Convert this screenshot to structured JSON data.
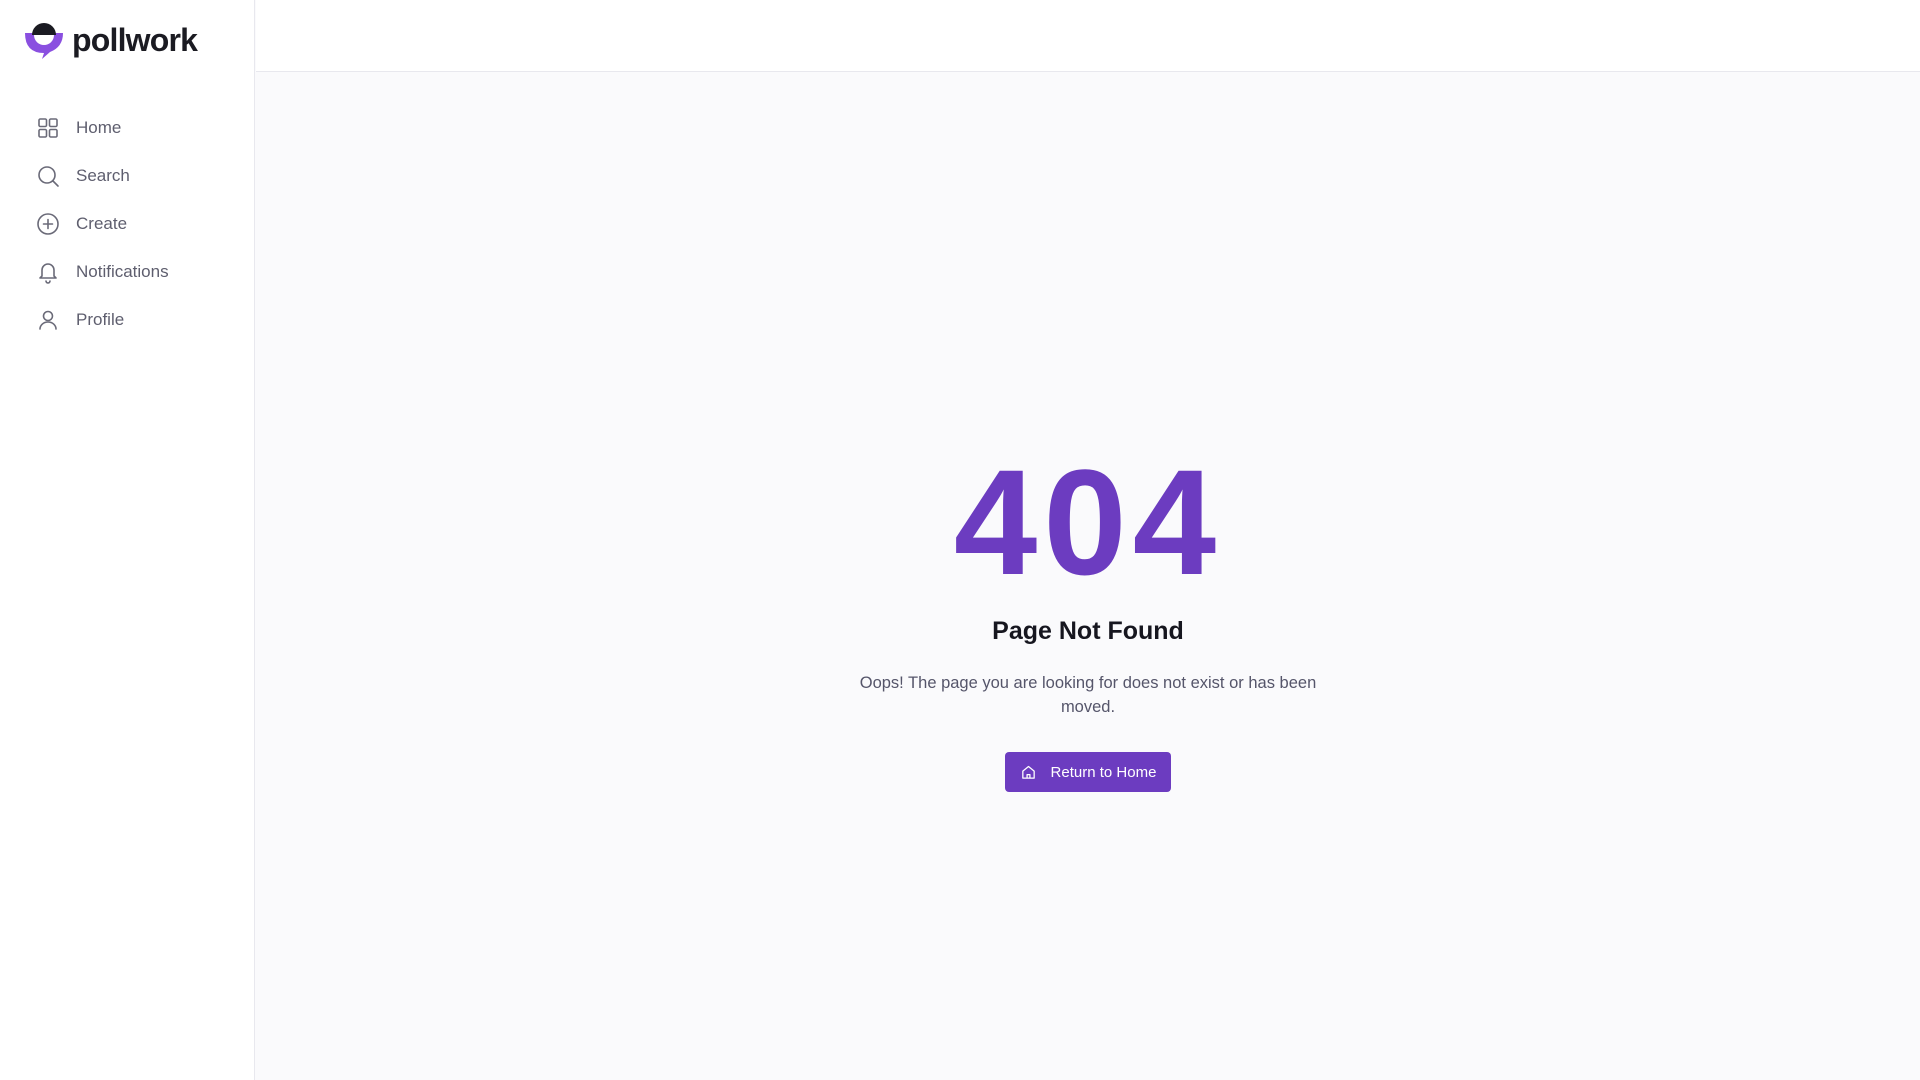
{
  "brand": {
    "name": "pollwork",
    "accent": "#6c3cc0"
  },
  "sidebar": {
    "items": [
      {
        "label": "Home",
        "icon": "grid-icon"
      },
      {
        "label": "Search",
        "icon": "search-icon"
      },
      {
        "label": "Create",
        "icon": "plus-circle-icon"
      },
      {
        "label": "Notifications",
        "icon": "bell-icon"
      },
      {
        "label": "Profile",
        "icon": "user-icon"
      }
    ]
  },
  "error": {
    "code": "404",
    "title": "Page Not Found",
    "message": "Oops! The page you are looking for does not exist or has been moved.",
    "button_label": "Return to Home",
    "button_icon": "home-icon"
  }
}
